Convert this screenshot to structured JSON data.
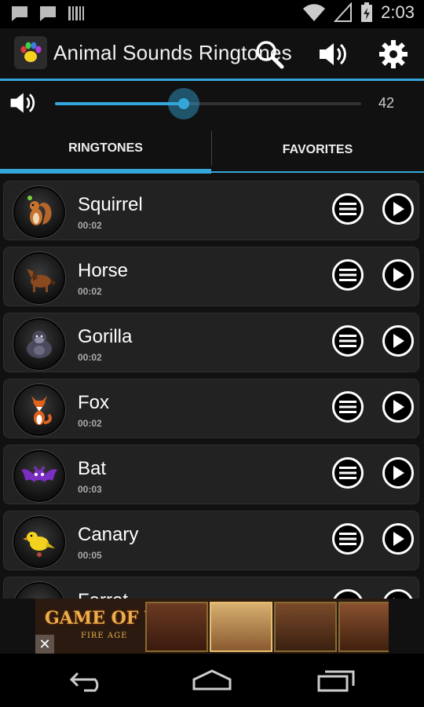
{
  "status_bar": {
    "time": "2:03",
    "icons": [
      "chat-icon",
      "chat-icon",
      "barcode-icon",
      "wifi-icon",
      "signal-icon",
      "battery-charging-icon"
    ]
  },
  "action_bar": {
    "title": "Animal Sounds Ringtones",
    "icons": [
      "paw-app-icon",
      "search-icon",
      "volume-icon",
      "gear-icon"
    ]
  },
  "volume": {
    "value_label": "42",
    "level_fraction": 0.42
  },
  "tabs": [
    {
      "label": "RINGTONES",
      "active": true
    },
    {
      "label": "FAVORITES",
      "active": false
    }
  ],
  "ringtones": [
    {
      "name": "Squirrel",
      "duration": "00:02",
      "icon": "squirrel-icon"
    },
    {
      "name": "Horse",
      "duration": "00:02",
      "icon": "horse-icon"
    },
    {
      "name": "Gorilla",
      "duration": "00:02",
      "icon": "gorilla-icon"
    },
    {
      "name": "Fox",
      "duration": "00:02",
      "icon": "fox-icon"
    },
    {
      "name": "Bat",
      "duration": "00:03",
      "icon": "bat-icon"
    },
    {
      "name": "Canary",
      "duration": "00:05",
      "icon": "canary-icon"
    },
    {
      "name": "Ferret",
      "duration": "",
      "icon": "ferret-icon"
    }
  ],
  "ad": {
    "logo_text": "GAME OF WAR",
    "sub_text": "FIRE AGE",
    "close_glyph": "✕"
  },
  "nav_bar": {
    "icons": [
      "back-icon",
      "home-icon",
      "recent-apps-icon"
    ]
  },
  "colors": {
    "accent": "#33a7d9",
    "background": "#111111",
    "row_background": "#222222"
  }
}
